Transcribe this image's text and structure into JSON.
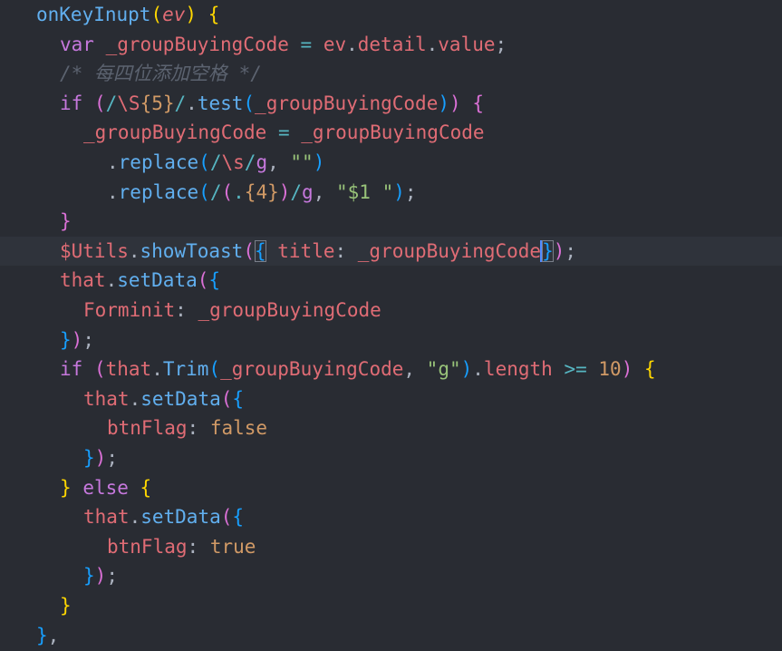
{
  "colors": {
    "background": "#292c33",
    "current_line": "#2f333b",
    "default": "#abb2bf",
    "function": "#61afef",
    "keyword": "#c678dd",
    "variable": "#e06c75",
    "string": "#98c379",
    "number": "#d19a66",
    "comment": "#5c6370",
    "operator": "#56b6c2",
    "bracket_yellow": "#ffd700",
    "bracket_pink": "#da70d6",
    "bracket_blue": "#179fff"
  },
  "editor": {
    "current_line_index": 8,
    "lines": [
      {
        "indent": 1,
        "tokens": [
          [
            "onKeyInupt",
            "#61afef"
          ],
          [
            "(",
            "#ffd700"
          ],
          [
            "ev",
            "#e06c75",
            "it"
          ],
          [
            ")",
            "#ffd700"
          ],
          [
            " ",
            "#abb2bf"
          ],
          [
            "{",
            "#ffd700"
          ]
        ]
      },
      {
        "indent": 2,
        "tokens": [
          [
            "var",
            "#c678dd"
          ],
          [
            " _groupBuyingCode ",
            "#e06c75"
          ],
          [
            "=",
            "#56b6c2"
          ],
          [
            " ev",
            "#e06c75"
          ],
          [
            ".",
            "#abb2bf"
          ],
          [
            "detail",
            "#e06c75"
          ],
          [
            ".",
            "#abb2bf"
          ],
          [
            "value",
            "#e06c75"
          ],
          [
            ";",
            "#abb2bf"
          ]
        ]
      },
      {
        "indent": 2,
        "tokens": [
          [
            "/* 每四位添加空格 */",
            "#5c6370",
            "it"
          ]
        ]
      },
      {
        "indent": 2,
        "tokens": [
          [
            "if",
            "#c678dd"
          ],
          [
            " ",
            "#abb2bf"
          ],
          [
            "(",
            "#da70d6"
          ],
          [
            "/",
            "#56b6c2"
          ],
          [
            "\\S",
            "#e06c75"
          ],
          [
            "{5}",
            "#d19a66"
          ],
          [
            "/",
            "#56b6c2"
          ],
          [
            ".",
            "#abb2bf"
          ],
          [
            "test",
            "#61afef"
          ],
          [
            "(",
            "#179fff"
          ],
          [
            "_groupBuyingCode",
            "#e06c75"
          ],
          [
            ")",
            "#179fff"
          ],
          [
            ")",
            "#da70d6"
          ],
          [
            " ",
            "#abb2bf"
          ],
          [
            "{",
            "#da70d6"
          ]
        ]
      },
      {
        "indent": 3,
        "tokens": [
          [
            "_groupBuyingCode ",
            "#e06c75"
          ],
          [
            "=",
            "#56b6c2"
          ],
          [
            " _groupBuyingCode",
            "#e06c75"
          ]
        ]
      },
      {
        "indent": 4,
        "tokens": [
          [
            ".",
            "#abb2bf"
          ],
          [
            "replace",
            "#61afef"
          ],
          [
            "(",
            "#179fff"
          ],
          [
            "/",
            "#56b6c2"
          ],
          [
            "\\s",
            "#e06c75"
          ],
          [
            "/",
            "#56b6c2"
          ],
          [
            "g",
            "#c678dd"
          ],
          [
            ", ",
            "#abb2bf"
          ],
          [
            "\"\"",
            "#98c379"
          ],
          [
            ")",
            "#179fff"
          ]
        ]
      },
      {
        "indent": 4,
        "tokens": [
          [
            ".",
            "#abb2bf"
          ],
          [
            "replace",
            "#61afef"
          ],
          [
            "(",
            "#179fff"
          ],
          [
            "/",
            "#56b6c2"
          ],
          [
            "(",
            "#da70d6"
          ],
          [
            ".",
            "#56b6c2"
          ],
          [
            "{4}",
            "#d19a66"
          ],
          [
            ")",
            "#da70d6"
          ],
          [
            "/",
            "#56b6c2"
          ],
          [
            "g",
            "#c678dd"
          ],
          [
            ", ",
            "#abb2bf"
          ],
          [
            "\"$1 \"",
            "#98c379"
          ],
          [
            ")",
            "#179fff"
          ],
          [
            ";",
            "#abb2bf"
          ]
        ]
      },
      {
        "indent": 2,
        "tokens": [
          [
            "}",
            "#da70d6"
          ]
        ]
      },
      {
        "indent": 2,
        "tokens": [
          [
            "$Utils",
            "#e06c75"
          ],
          [
            ".",
            "#abb2bf"
          ],
          [
            "showToast",
            "#61afef"
          ],
          [
            "(",
            "#da70d6"
          ],
          [
            "{",
            "#179fff",
            "hl"
          ],
          [
            " title",
            "#e06c75"
          ],
          [
            ":",
            "#abb2bf"
          ],
          [
            " _groupBuyingCode",
            "#e06c75"
          ],
          [
            "|",
            "cursor"
          ],
          [
            "}",
            "#179fff",
            "hl"
          ],
          [
            ")",
            "#da70d6"
          ],
          [
            ";",
            "#abb2bf"
          ]
        ]
      },
      {
        "indent": 2,
        "tokens": [
          [
            "that",
            "#e06c75"
          ],
          [
            ".",
            "#abb2bf"
          ],
          [
            "setData",
            "#61afef"
          ],
          [
            "(",
            "#da70d6"
          ],
          [
            "{",
            "#179fff"
          ]
        ]
      },
      {
        "indent": 3,
        "tokens": [
          [
            "Forminit",
            "#e06c75"
          ],
          [
            ":",
            "#abb2bf"
          ],
          [
            " _groupBuyingCode",
            "#e06c75"
          ]
        ]
      },
      {
        "indent": 2,
        "tokens": [
          [
            "}",
            "#179fff"
          ],
          [
            ")",
            "#da70d6"
          ],
          [
            ";",
            "#abb2bf"
          ]
        ]
      },
      {
        "indent": 2,
        "tokens": [
          [
            "if",
            "#c678dd"
          ],
          [
            " ",
            "#abb2bf"
          ],
          [
            "(",
            "#da70d6"
          ],
          [
            "that",
            "#e06c75"
          ],
          [
            ".",
            "#abb2bf"
          ],
          [
            "Trim",
            "#61afef"
          ],
          [
            "(",
            "#179fff"
          ],
          [
            "_groupBuyingCode",
            "#e06c75"
          ],
          [
            ", ",
            "#abb2bf"
          ],
          [
            "\"g\"",
            "#98c379"
          ],
          [
            ")",
            "#179fff"
          ],
          [
            ".",
            "#abb2bf"
          ],
          [
            "length",
            "#e06c75"
          ],
          [
            " ",
            "#abb2bf"
          ],
          [
            ">=",
            "#56b6c2"
          ],
          [
            " ",
            "#abb2bf"
          ],
          [
            "10",
            "#d19a66"
          ],
          [
            ")",
            "#da70d6"
          ],
          [
            " ",
            "#abb2bf"
          ],
          [
            "{",
            "#ffd700"
          ]
        ]
      },
      {
        "indent": 3,
        "tokens": [
          [
            "that",
            "#e06c75"
          ],
          [
            ".",
            "#abb2bf"
          ],
          [
            "setData",
            "#61afef"
          ],
          [
            "(",
            "#da70d6"
          ],
          [
            "{",
            "#179fff"
          ]
        ]
      },
      {
        "indent": 4,
        "tokens": [
          [
            "btnFlag",
            "#e06c75"
          ],
          [
            ": ",
            "#abb2bf"
          ],
          [
            "false",
            "#d19a66"
          ]
        ]
      },
      {
        "indent": 3,
        "tokens": [
          [
            "}",
            "#179fff"
          ],
          [
            ")",
            "#da70d6"
          ],
          [
            ";",
            "#abb2bf"
          ]
        ]
      },
      {
        "indent": 2,
        "tokens": [
          [
            "}",
            "#ffd700"
          ],
          [
            " ",
            "#abb2bf"
          ],
          [
            "else",
            "#c678dd"
          ],
          [
            " ",
            "#abb2bf"
          ],
          [
            "{",
            "#ffd700"
          ]
        ]
      },
      {
        "indent": 3,
        "tokens": [
          [
            "that",
            "#e06c75"
          ],
          [
            ".",
            "#abb2bf"
          ],
          [
            "setData",
            "#61afef"
          ],
          [
            "(",
            "#da70d6"
          ],
          [
            "{",
            "#179fff"
          ]
        ]
      },
      {
        "indent": 4,
        "tokens": [
          [
            "btnFlag",
            "#e06c75"
          ],
          [
            ": ",
            "#abb2bf"
          ],
          [
            "true",
            "#d19a66"
          ]
        ]
      },
      {
        "indent": 3,
        "tokens": [
          [
            "}",
            "#179fff"
          ],
          [
            ")",
            "#da70d6"
          ],
          [
            ";",
            "#abb2bf"
          ]
        ]
      },
      {
        "indent": 2,
        "tokens": [
          [
            "}",
            "#ffd700"
          ]
        ]
      },
      {
        "indent": 1,
        "tokens": [
          [
            "}",
            "#179fff"
          ],
          [
            ",",
            "#abb2bf"
          ]
        ]
      }
    ]
  }
}
